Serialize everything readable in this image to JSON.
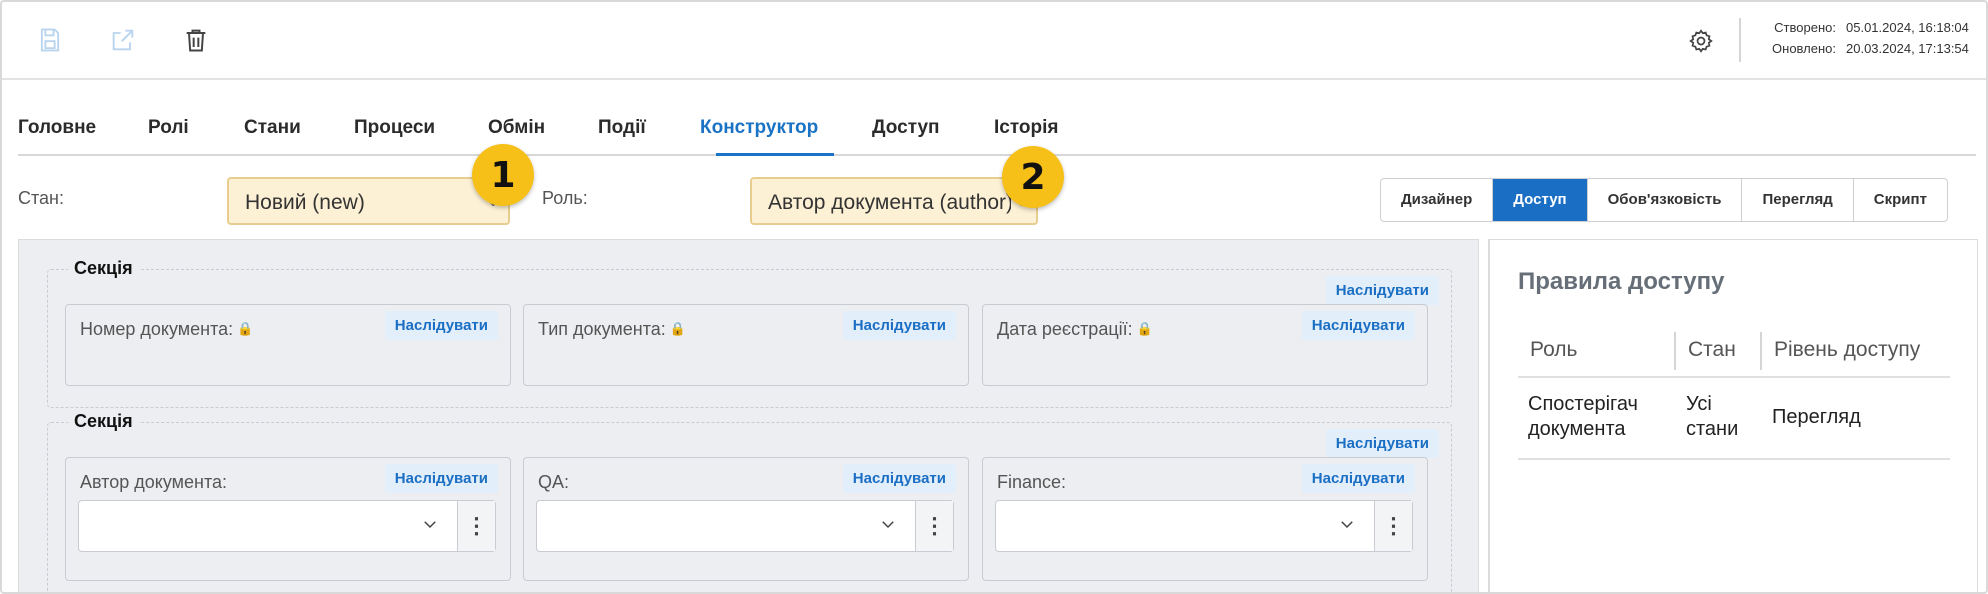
{
  "toolbar": {
    "icons": [
      "save-icon",
      "open-external-icon",
      "trash-icon",
      "gear-icon"
    ],
    "created_label": "Створено:",
    "created_value": "05.01.2024, 16:18:04",
    "updated_label": "Оновлено:",
    "updated_value": "20.03.2024, 17:13:54"
  },
  "tabs": [
    "Головне",
    "Ролі",
    "Стани",
    "Процеси",
    "Обмін",
    "Події",
    "Конструктор",
    "Доступ",
    "Історія"
  ],
  "active_tab": "Конструктор",
  "filters": {
    "state_label": "Стан:",
    "state_value": "Новий (new)",
    "role_label": "Роль:",
    "role_value": "Автор документа (author)"
  },
  "badges": [
    "1",
    "2"
  ],
  "view_modes": [
    "Дизайнер",
    "Доступ",
    "Обов'язковість",
    "Перегляд",
    "Скрипт"
  ],
  "active_view_mode": "Доступ",
  "sections": [
    {
      "title": "Секція",
      "inherit": "Наслідувати",
      "fields": [
        {
          "label": "Номер документа:",
          "inherit": "Наслідувати",
          "locked": true
        },
        {
          "label": "Тип документа:",
          "inherit": "Наслідувати",
          "locked": true
        },
        {
          "label": "Дата реєстрації:",
          "inherit": "Наслідувати",
          "locked": true
        }
      ]
    },
    {
      "title": "Секція",
      "inherit": "Наслідувати",
      "fields": [
        {
          "label": "Автор документа:",
          "inherit": "Наслідувати",
          "value": ""
        },
        {
          "label": "QA:",
          "inherit": "Наслідувати",
          "value": ""
        },
        {
          "label": "Finance:",
          "inherit": "Наслідувати",
          "value": ""
        }
      ]
    }
  ],
  "access_panel": {
    "title": "Правила доступу",
    "columns": [
      "Роль",
      "Стан",
      "Рівень доступу"
    ],
    "rows": [
      {
        "role_line1": "Спостерігач",
        "role_line2": "документа",
        "state_line1": "Усі",
        "state_line2": "стани",
        "level": "Перегляд"
      }
    ]
  },
  "colors": {
    "accent": "#1a6fc4",
    "dropdown_bg": "#fdf1d5",
    "badge": "#f6c018",
    "canvas_bg": "#eceef1"
  }
}
